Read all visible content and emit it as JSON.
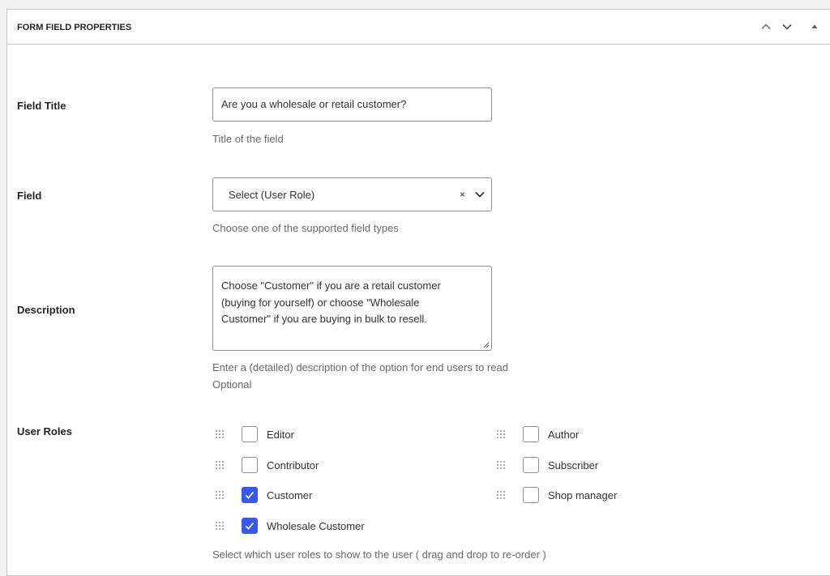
{
  "panel": {
    "title": "FORM FIELD PROPERTIES",
    "controls": [
      "chevron-up-icon",
      "chevron-down-icon",
      "triangle-up-icon"
    ]
  },
  "field_title": {
    "label": "Field Title",
    "value": "Are you a wholesale or retail customer?",
    "help": "Title of the field"
  },
  "field": {
    "label": "Field",
    "selected": "Select (User Role)",
    "clear_glyph": "×",
    "help": "Choose one of the supported field types"
  },
  "description": {
    "label": "Description",
    "value_lines": [
      "Choose \"Customer\" if you are a retail customer",
      "(buying for yourself) or choose \"Wholesale",
      "Customer\" if you are buying in bulk to resell."
    ],
    "help": "Enter a (detailed) description of the option for end users to read",
    "help2": "Optional"
  },
  "user_roles": {
    "label": "User Roles",
    "items": [
      {
        "label": "Editor",
        "checked": false
      },
      {
        "label": "Author",
        "checked": false
      },
      {
        "label": "Contributor",
        "checked": false
      },
      {
        "label": "Subscriber",
        "checked": false
      },
      {
        "label": "Customer",
        "checked": true
      },
      {
        "label": "Shop manager",
        "checked": false
      },
      {
        "label": "Wholesale Customer",
        "checked": true
      }
    ],
    "help": "Select which user roles to show to the user ( drag and drop to re-order )"
  },
  "colors": {
    "checkbox_checked": "#3858e9",
    "border": "#c3c4c7",
    "help_text": "#646970"
  }
}
